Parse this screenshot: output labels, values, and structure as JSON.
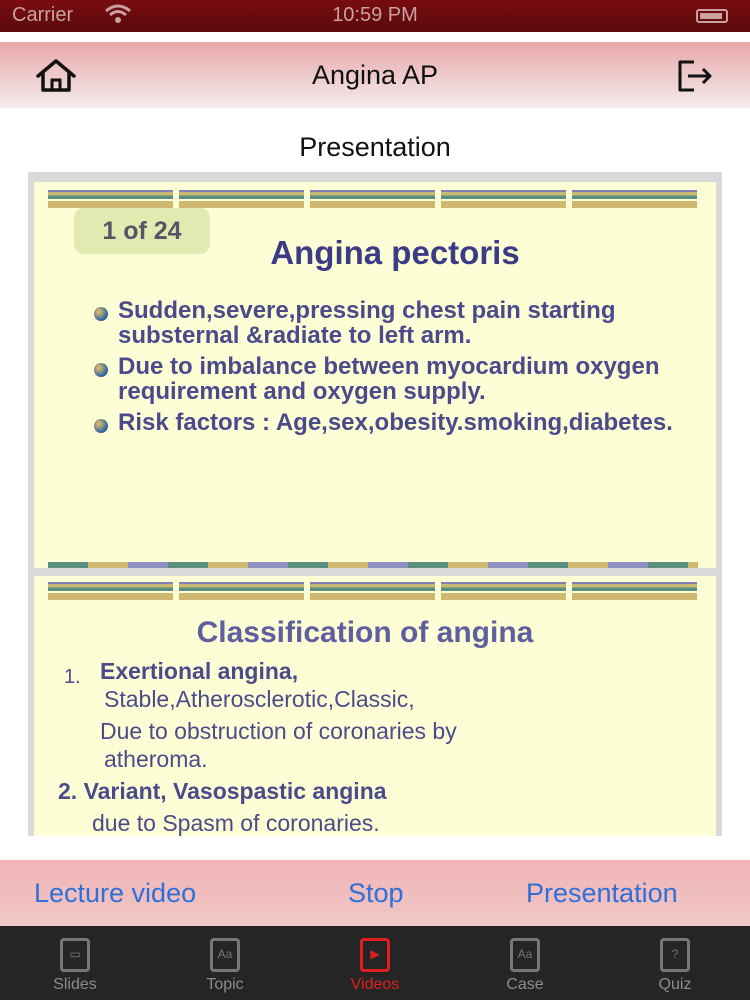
{
  "status": {
    "carrier": "Carrier",
    "time": "10:59 PM"
  },
  "nav": {
    "title": "Angina AP",
    "home_icon": "home-icon",
    "exit_icon": "logout-icon"
  },
  "section_title": "Presentation",
  "slide1": {
    "counter": "1 of 24",
    "heading": "Angina pectoris",
    "bullets": [
      "Sudden,severe,pressing chest pain starting substernal &radiate to left arm.",
      "Due to imbalance between myocardium oxygen requirement and oxygen supply.",
      "Risk factors : Age,sex,obesity.smoking,diabetes."
    ]
  },
  "slide2": {
    "heading": "Classification of angina",
    "item1_num": "1.",
    "item1_title": "Exertional angina,",
    "item1_sub": "Stable,Atherosclerotic,Classic,",
    "item1_desc1": "Due to obstruction of coronaries by",
    "item1_desc2": "atheroma.",
    "item2_title": "2. Variant, Vasospastic angina",
    "item2_desc": "due to Spasm of coronaries."
  },
  "actions": {
    "lecture_video": "Lecture video",
    "stop": "Stop",
    "presentation": "Presentation"
  },
  "tabs": [
    {
      "label": "Slides",
      "icon": "slides-icon"
    },
    {
      "label": "Topic",
      "icon": "topic-icon"
    },
    {
      "label": "Videos",
      "icon": "videos-icon",
      "active": true
    },
    {
      "label": "Case",
      "icon": "case-icon"
    },
    {
      "label": "Quiz",
      "icon": "quiz-icon"
    }
  ],
  "colors": {
    "accent": "#2e6fd8",
    "active_tab": "#e02020",
    "slide_text": "#4b4b8c",
    "slide_bg": "#fdfdd6"
  }
}
